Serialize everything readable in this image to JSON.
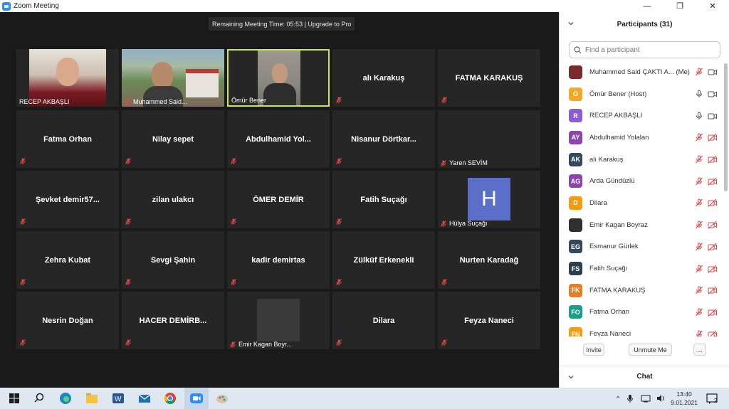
{
  "window": {
    "title": "Zoom Meeting",
    "minimize": "—",
    "maximize": "❐",
    "close": "✕"
  },
  "meeting": {
    "remaining_time": "Remaining Meeting Time: 05:53 | Upgrade to Pro",
    "tiles": [
      {
        "name": "RECEP AKBAŞLI",
        "kind": "video1",
        "muted": false
      },
      {
        "name": "Muhammed Said...",
        "kind": "video2",
        "muted": true
      },
      {
        "name": "Ömür Bener",
        "kind": "video3",
        "muted": false,
        "active": true
      },
      {
        "name": "alı  Karakuş",
        "kind": "center",
        "muted": true
      },
      {
        "name": "FATMA KARAKUŞ",
        "kind": "center",
        "muted": true
      },
      {
        "name": "Fatma Orhan",
        "kind": "center",
        "muted": true
      },
      {
        "name": "Nilay sepet",
        "kind": "center",
        "muted": true
      },
      {
        "name": "Abdulhamid  Yol...",
        "kind": "center",
        "muted": true
      },
      {
        "name": "Nisanur  Dörtkar...",
        "kind": "center",
        "muted": true
      },
      {
        "name": "Yaren SEVİM",
        "kind": "label",
        "muted": true
      },
      {
        "name": "Şevket  demir57...",
        "kind": "center",
        "muted": true
      },
      {
        "name": "zilan ulakcı",
        "kind": "center",
        "muted": true
      },
      {
        "name": "ÖMER DEMİR",
        "kind": "center",
        "muted": true
      },
      {
        "name": "Fatih Suçağı",
        "kind": "center",
        "muted": true
      },
      {
        "name": "Hülya Suçağı",
        "kind": "avatar",
        "avatar": "H",
        "muted": true
      },
      {
        "name": "Zehra Kubat",
        "kind": "center",
        "muted": true
      },
      {
        "name": "Sevgi Şahin",
        "kind": "center",
        "muted": true
      },
      {
        "name": "kadir demirtas",
        "kind": "center",
        "muted": true
      },
      {
        "name": "Zülküf Erkenekli",
        "kind": "center",
        "muted": true
      },
      {
        "name": "Nurten Karadağ",
        "kind": "center",
        "muted": true
      },
      {
        "name": "Nesrin Doğan",
        "kind": "center",
        "muted": true
      },
      {
        "name": "HACER   DEMİRB...",
        "kind": "center",
        "muted": true
      },
      {
        "name": "Emir Kagan Boyr...",
        "kind": "gray",
        "muted": true
      },
      {
        "name": "Dilara",
        "kind": "center",
        "muted": true
      },
      {
        "name": "Feyza Naneci",
        "kind": "center",
        "muted": true
      }
    ]
  },
  "participants": {
    "title": "Participants (31)",
    "search_placeholder": "Find a participant",
    "list": [
      {
        "name": "Muhammed Said ÇAKTI A...",
        "suffix": "(Me)",
        "initials": "",
        "color": "#7a2a2a",
        "mic": "muted",
        "cam": "on"
      },
      {
        "name": "Ömür Bener (Host)",
        "initials": "Ö",
        "color": "#f5a623",
        "mic": "on",
        "cam": "on"
      },
      {
        "name": "RECEP AKBAŞLI",
        "initials": "R",
        "color": "#8e5bd6",
        "mic": "on",
        "cam": "on"
      },
      {
        "name": "Abdulhamid Yolalan",
        "initials": "AY",
        "color": "#8e44ad",
        "mic": "muted",
        "cam": "off"
      },
      {
        "name": "alı  Karakuş",
        "initials": "AK",
        "color": "#34495e",
        "mic": "muted",
        "cam": "off"
      },
      {
        "name": "Arda Gündüzlü",
        "initials": "AG",
        "color": "#8e44ad",
        "mic": "muted",
        "cam": "off"
      },
      {
        "name": "Dilara",
        "initials": "D",
        "color": "#f39c12",
        "mic": "muted",
        "cam": "off"
      },
      {
        "name": "Emir Kagan Boyraz",
        "initials": "",
        "color": "#2f2f2f",
        "mic": "muted",
        "cam": "off"
      },
      {
        "name": "Esmanur Gürlek",
        "initials": "EG",
        "color": "#34495e",
        "mic": "muted",
        "cam": "off"
      },
      {
        "name": "Fatih Suçağı",
        "initials": "FS",
        "color": "#2c3e50",
        "mic": "muted",
        "cam": "off"
      },
      {
        "name": "FATMA KARAKUŞ",
        "initials": "FK",
        "color": "#e67e22",
        "mic": "muted",
        "cam": "off"
      },
      {
        "name": "Fatma Orhan",
        "initials": "FO",
        "color": "#16a085",
        "mic": "muted",
        "cam": "off"
      },
      {
        "name": "Feyza Naneci",
        "initials": "FN",
        "color": "#f39c12",
        "mic": "muted",
        "cam": "off"
      }
    ],
    "invite": "Invite",
    "unmute_me": "Unmute Me",
    "more": "...",
    "chat": "Chat"
  },
  "taskbar": {
    "time": "13:40",
    "date": "9.01.2021",
    "notifications": "2"
  },
  "colors": {
    "active_border": "#c9e562",
    "muted_red": "#e04848"
  }
}
